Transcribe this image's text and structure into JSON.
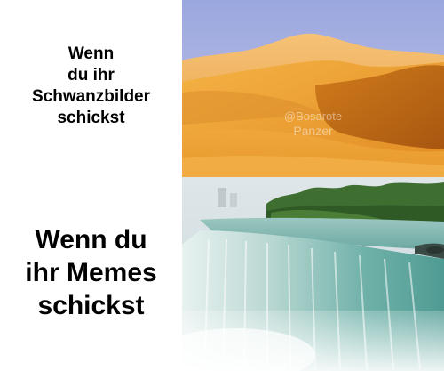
{
  "meme": {
    "top": {
      "caption": "Wenn\ndu ihr\nSchwanzbilder\nschickst",
      "image_subject": "desert-sand-dunes",
      "watermark_handle": "@Bosarote",
      "watermark_name": "Panzer"
    },
    "bottom": {
      "caption": "Wenn du\nihr Memes\nschickst",
      "image_subject": "waterfall"
    }
  },
  "colors": {
    "background": "#ffffff",
    "text": "#000000",
    "sky_top": "#a9b4e4",
    "sand_light": "#f3b34a",
    "sand_dark": "#c16a16",
    "water": "#5fa7a1",
    "foliage": "#3c6b2e"
  }
}
